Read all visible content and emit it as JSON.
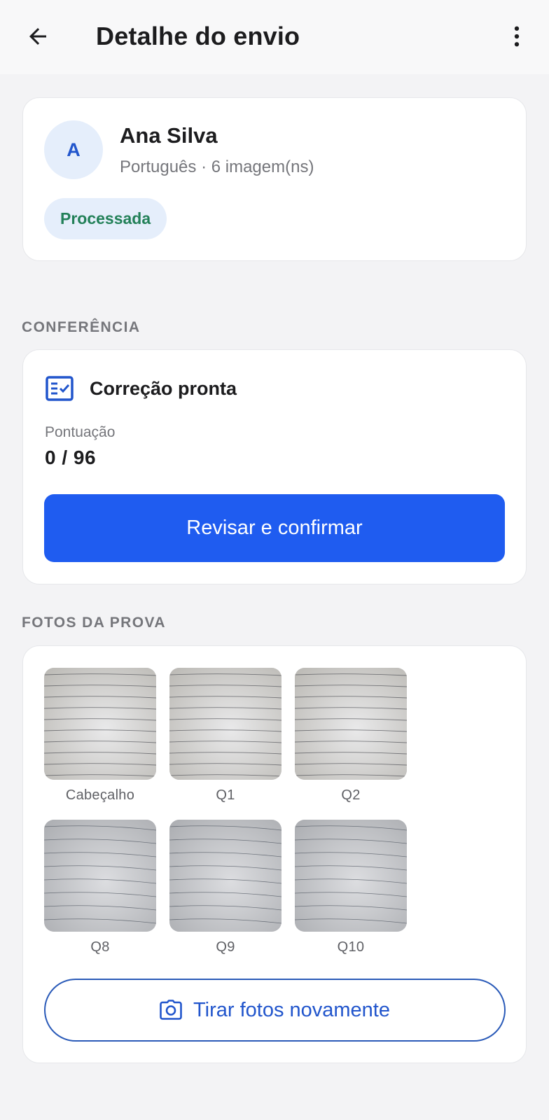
{
  "header": {
    "back_icon": "arrow-left-icon",
    "title": "Detalhe do envio",
    "more_icon": "more-vertical-icon"
  },
  "student": {
    "avatar_initial": "A",
    "name": "Ana Silva",
    "meta": "Português · 6 imagem(ns)",
    "status": "Processada"
  },
  "conferencia": {
    "section_label": "CONFERÊNCIA",
    "icon": "checklist-icon",
    "title": "Correção pronta",
    "score_label": "Pontuação",
    "score_value": "0 / 96",
    "button_label": "Revisar e confirmar"
  },
  "fotos": {
    "section_label": "FOTOS DA PROVA",
    "items": [
      {
        "label": "Cabeçalho"
      },
      {
        "label": "Q1"
      },
      {
        "label": "Q2"
      },
      {
        "label": "Q8"
      },
      {
        "label": "Q9"
      },
      {
        "label": "Q10"
      }
    ],
    "retake_icon": "camera-icon",
    "retake_label": "Tirar fotos novamente"
  },
  "colors": {
    "primary": "#1f5cf0",
    "status_text": "#228058",
    "badge_bg": "#e5eefb",
    "accent_blue": "#2155cc"
  }
}
